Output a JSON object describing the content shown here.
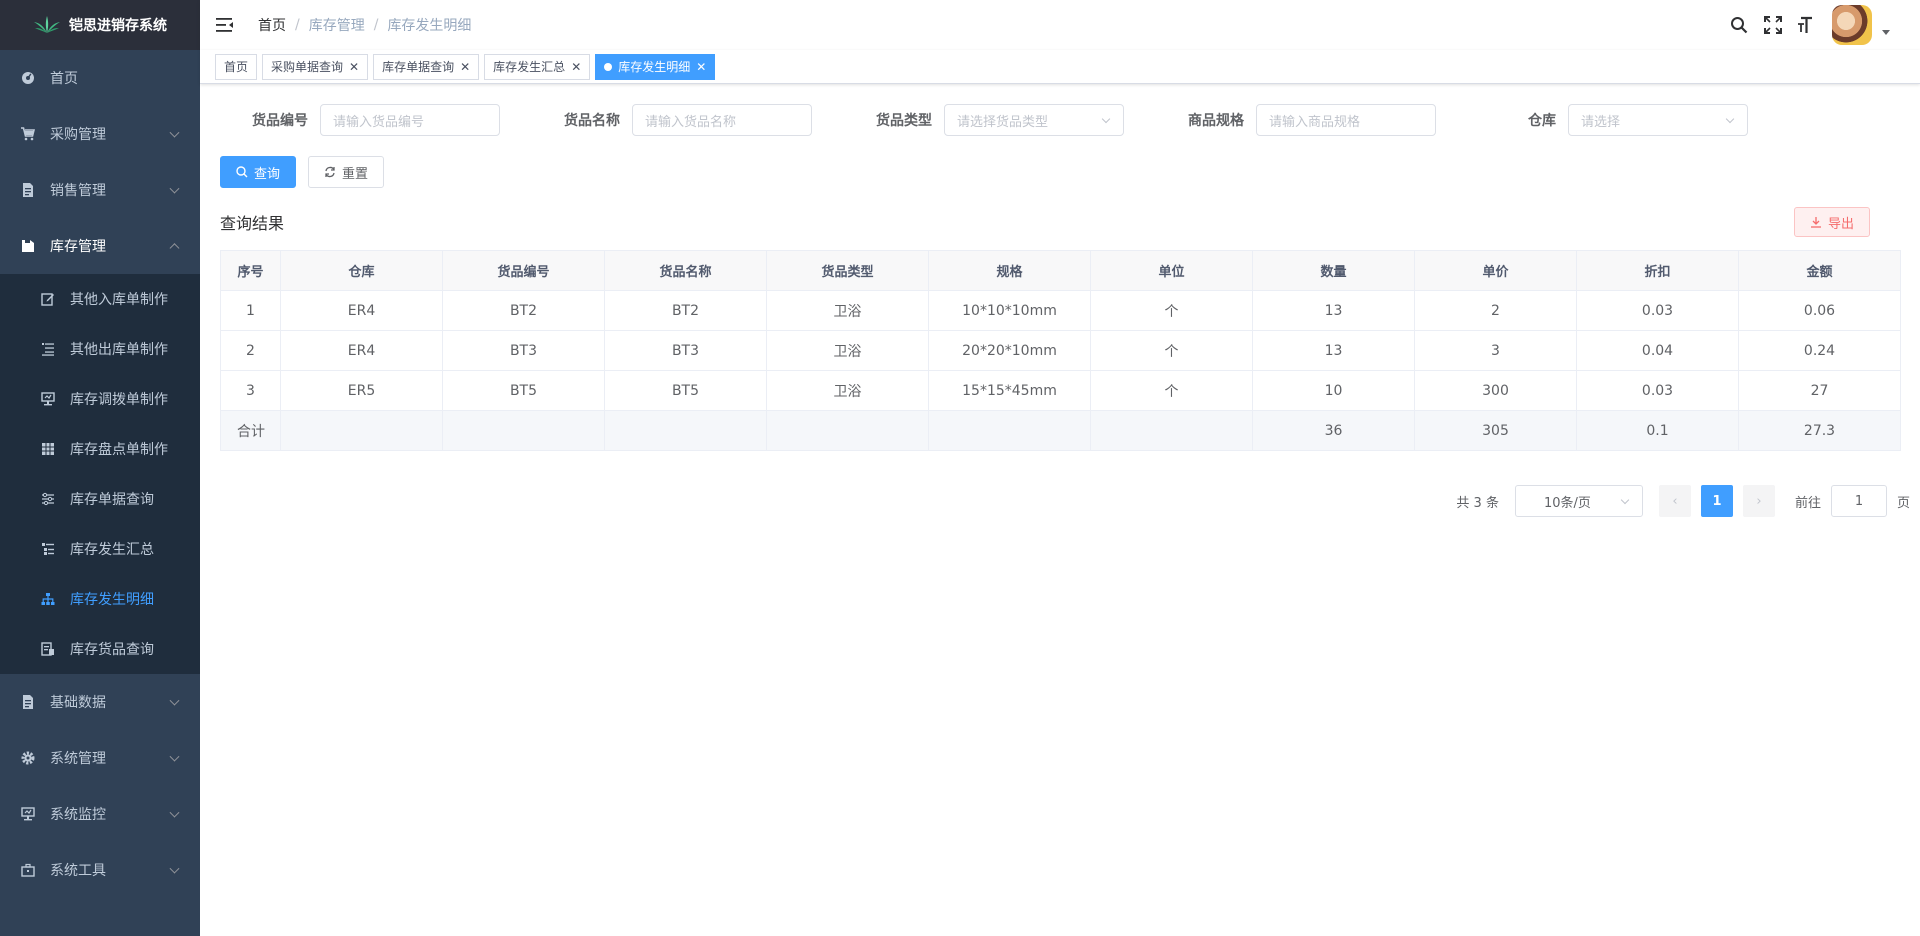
{
  "app": {
    "title": "铠思进销存系统"
  },
  "sidebar": {
    "items": [
      {
        "label": "首页",
        "icon": "dashboard-icon",
        "has_children": false
      },
      {
        "label": "采购管理",
        "icon": "cart-icon",
        "has_children": true
      },
      {
        "label": "销售管理",
        "icon": "document-icon",
        "has_children": true
      },
      {
        "label": "库存管理",
        "icon": "folder-icon",
        "has_children": true,
        "open": true
      }
    ],
    "stock_children": [
      {
        "label": "其他入库单制作",
        "icon": "edit-icon"
      },
      {
        "label": "其他出库单制作",
        "icon": "list-icon"
      },
      {
        "label": "库存调拨单制作",
        "icon": "monitor-icon"
      },
      {
        "label": "库存盘点单制作",
        "icon": "grid-icon"
      },
      {
        "label": "库存单据查询",
        "icon": "sliders-icon"
      },
      {
        "label": "库存发生汇总",
        "icon": "tree-table-icon"
      },
      {
        "label": "库存发生明细",
        "icon": "tree-icon",
        "active": true
      },
      {
        "label": "库存货品查询",
        "icon": "inventory-icon"
      }
    ],
    "bottom_items": [
      {
        "label": "基础数据",
        "icon": "document-icon"
      },
      {
        "label": "系统管理",
        "icon": "gear-icon"
      },
      {
        "label": "系统监控",
        "icon": "monitor-icon"
      },
      {
        "label": "系统工具",
        "icon": "toolbox-icon"
      }
    ]
  },
  "navbar": {
    "breadcrumb": [
      "首页",
      "库存管理",
      "库存发生明细"
    ]
  },
  "tags": [
    {
      "label": "首页",
      "closable": false,
      "active": false
    },
    {
      "label": "采购单据查询",
      "closable": true,
      "active": false
    },
    {
      "label": "库存单据查询",
      "closable": true,
      "active": false
    },
    {
      "label": "库存发生汇总",
      "closable": true,
      "active": false
    },
    {
      "label": "库存发生明细",
      "closable": true,
      "active": true
    }
  ],
  "filters": {
    "code": {
      "label": "货品编号",
      "placeholder": "请输入货品编号"
    },
    "name": {
      "label": "货品名称",
      "placeholder": "请输入货品名称"
    },
    "type": {
      "label": "货品类型",
      "placeholder": "请选择货品类型"
    },
    "spec": {
      "label": "商品规格",
      "placeholder": "请输入商品规格"
    },
    "warehouse": {
      "label": "仓库",
      "placeholder": "请选择"
    }
  },
  "buttons": {
    "search": "查询",
    "reset": "重置",
    "export": "导出"
  },
  "result": {
    "title": "查询结果"
  },
  "table": {
    "headers": [
      "序号",
      "仓库",
      "货品编号",
      "货品名称",
      "货品类型",
      "规格",
      "单位",
      "数量",
      "单价",
      "折扣",
      "金额"
    ],
    "rows": [
      [
        "1",
        "ER4",
        "BT2",
        "BT2",
        "卫浴",
        "10*10*10mm",
        "个",
        "13",
        "2",
        "0.03",
        "0.06"
      ],
      [
        "2",
        "ER4",
        "BT3",
        "BT3",
        "卫浴",
        "20*20*10mm",
        "个",
        "13",
        "3",
        "0.04",
        "0.24"
      ],
      [
        "3",
        "ER5",
        "BT5",
        "BT5",
        "卫浴",
        "15*15*45mm",
        "个",
        "10",
        "300",
        "0.03",
        "27"
      ]
    ],
    "summary": [
      "合计",
      "",
      "",
      "",
      "",
      "",
      "",
      "36",
      "305",
      "0.1",
      "27.3"
    ]
  },
  "pagination": {
    "total": "共 3 条",
    "page_size": "10条/页",
    "current": "1",
    "goto_label": "前往",
    "goto_value": "1",
    "page_unit": "页"
  }
}
